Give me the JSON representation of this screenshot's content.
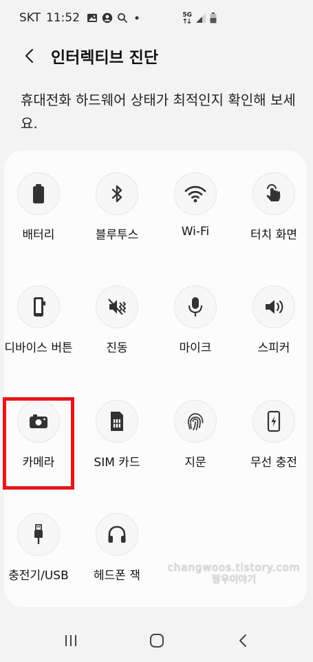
{
  "status_bar": {
    "carrier": "SKT",
    "time": "11:52",
    "network_badge": "5G"
  },
  "header": {
    "title": "인터렉티브 진단"
  },
  "description": "휴대전화 하드웨어 상태가 최적인지 확인해 보세요.",
  "tiles": [
    {
      "label": "배터리",
      "icon": "battery-icon"
    },
    {
      "label": "블루투스",
      "icon": "bluetooth-icon"
    },
    {
      "label": "Wi-Fi",
      "icon": "wifi-icon"
    },
    {
      "label": "터치 화면",
      "icon": "touch-icon"
    },
    {
      "label": "디바이스 버튼",
      "icon": "device-button-icon"
    },
    {
      "label": "진동",
      "icon": "vibration-icon"
    },
    {
      "label": "마이크",
      "icon": "microphone-icon"
    },
    {
      "label": "스피커",
      "icon": "speaker-icon"
    },
    {
      "label": "카메라",
      "icon": "camera-icon"
    },
    {
      "label": "SIM 카드",
      "icon": "sim-card-icon"
    },
    {
      "label": "지문",
      "icon": "fingerprint-icon"
    },
    {
      "label": "무선 충전",
      "icon": "wireless-charging-icon"
    },
    {
      "label": "충전기/USB",
      "icon": "usb-icon"
    },
    {
      "label": "헤드폰 잭",
      "icon": "headphones-icon"
    }
  ],
  "watermark": {
    "url": "changwoos.tistory.com",
    "name": "짱우이야기"
  },
  "colors": {
    "highlight": "#e8161b",
    "background": "#f3f3f3",
    "card": "#fcfcfc"
  }
}
